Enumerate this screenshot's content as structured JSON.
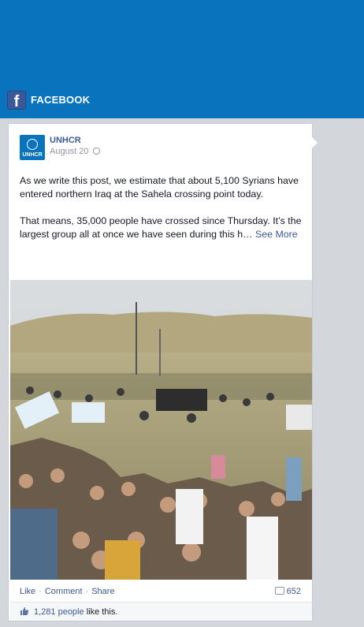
{
  "header": {
    "fb_logo": "f",
    "title": "FACEBOOK"
  },
  "post": {
    "avatar_text": "UNHCR",
    "author": "UNHCR",
    "date": "August 20",
    "paragraph1": "As we write this post, we estimate that about 5,100 Syrians have entered northern Iraq at the Sahela crossing point today.",
    "paragraph2": "That means, 35,000 people have crossed since Thursday. It’s the largest group all at once we have seen during this h…",
    "see_more": "See More",
    "actions": {
      "like": "Like",
      "comment": "Comment",
      "share": "Share",
      "separator": "·"
    },
    "comment_count": "652",
    "likes": {
      "count": "1,281 people",
      "suffix": "like this."
    }
  },
  "colors": {
    "brand_blue": "#0a73be",
    "facebook_blue": "#3b5998",
    "background": "#d3d6db"
  },
  "icons": [
    "facebook-logo-icon",
    "globe-icon",
    "comment-icon",
    "thumbs-up-icon"
  ]
}
